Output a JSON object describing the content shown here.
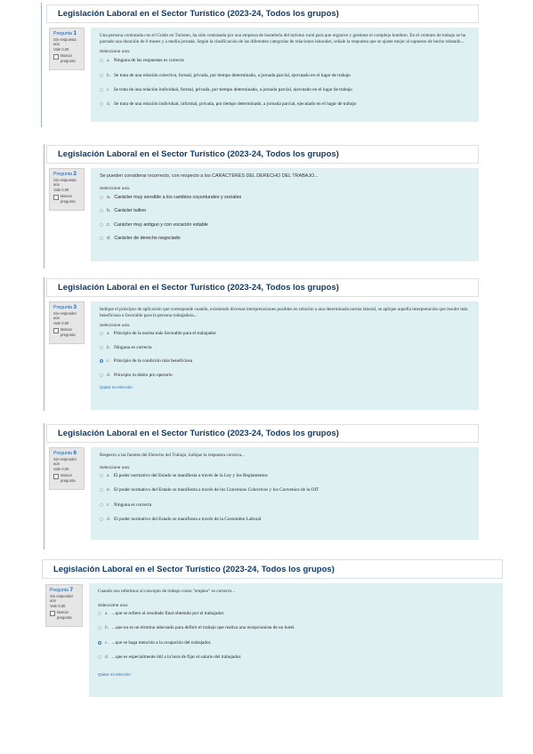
{
  "questions": [
    {
      "header": "Legislación Laboral en el Sector Turístico (2023-24, Todos los grupos)",
      "info": {
        "label": "Pregunta",
        "number": "1",
        "status": "Sin respuesta aún",
        "score": "Vale 0,00",
        "flag": "Marcar pregunta"
      },
      "text": "Una persona contratada con el Grado en Turismo, ha sido contratada por una empresa de hostelería del turismo rural para que organice y gestione el complejo hotelero. En el contrato de trabajo se ha pactado una duración de 6 meses y a media jornada. Según la clasificación de las diferentes categorías de relaciones laborales, señale la respuesta que se ajuste mejor al supuesto de hecho relatado...",
      "select_label": "Seleccione una:",
      "options": [
        {
          "letter": "a.",
          "text": "Ninguna de las respuestas es correcta"
        },
        {
          "letter": "b.",
          "text": "Se trata de una relación colectiva, formal, privada, por tiempo determinado, a jornada parcial, ejecutado en el lugar de trabajo"
        },
        {
          "letter": "c.",
          "text": "Se trata de una relación individual, formal, privada, por tiempo determinado, a jornada parcial, ejecutado en el lugar de trabajo"
        },
        {
          "letter": "d.",
          "text": "Se trata de una relación individual, informal, privada, por tiempo determinado, a jornada parcial, ejecutado en el lugar de trabajo"
        }
      ],
      "clear": ""
    },
    {
      "header": "Legislación Laboral en el Sector Turístico (2023-24, Todos los grupos)",
      "info": {
        "label": "Pregunta",
        "number": "2",
        "status": "Sin respuesta aún",
        "score": "Vale 0,00",
        "flag": "Marcar pregunta"
      },
      "text": "Se pueden considerar incorrecto, con respecto a los CARACTERES DEL DERECHO DEL TRABAJO...",
      "select_label": "Seleccione una:",
      "options": [
        {
          "letter": "a.",
          "text": "Carácter muy sensible a los cambios coyunturales y sociales"
        },
        {
          "letter": "b.",
          "text": "Carácter tuitivo"
        },
        {
          "letter": "c.",
          "text": "Carácter muy antiguo y con vocación estable"
        },
        {
          "letter": "d.",
          "text": "Carácter de derecho negociado"
        }
      ],
      "clear": ""
    },
    {
      "header": "Legislación Laboral en el Sector Turístico (2023-24, Todos los grupos)",
      "info": {
        "label": "Pregunta",
        "number": "3",
        "status": "Sin responder aún",
        "score": "Vale 0,00",
        "flag": "Marcar pregunta"
      },
      "text": "Indique el principio de aplicación que corresponde cuando, existiendo diversas interpretaciones posibles en relación a una determinada norma laboral, se aplique aquella interpretación que resulte más beneficiosa o favorable para la persona trabajadora...",
      "select_label": "Seleccione una:",
      "options": [
        {
          "letter": "a.",
          "text": "Principio de la norma más favorable para el trabajador"
        },
        {
          "letter": "b.",
          "text": "Ninguna es correcta"
        },
        {
          "letter": "c.",
          "text": "Principio de la condición más beneficiosa"
        },
        {
          "letter": "d.",
          "text": "Principio in dubio pro operario"
        }
      ],
      "clear": "Quitar mi elección"
    },
    {
      "header": "Legislación Laboral en el Sector Turístico (2023-24, Todos los grupos)",
      "info": {
        "label": "Pregunta",
        "number": "6",
        "status": "Sin responder aún",
        "score": "Vale 0,00",
        "flag": "Marcar pregunta"
      },
      "text": "Respecto a las fuentes del Derecho del Trabajo, indique la respuesta correcta...",
      "select_label": "Seleccione una:",
      "options": [
        {
          "letter": "a.",
          "text": "El poder normativo del Estado se manifiesta a través de la Ley y los Reglamentos"
        },
        {
          "letter": "b.",
          "text": "El poder normativo del Estado se manifiesta a través de los Convenios Colectivos y los Convenios de la OIT"
        },
        {
          "letter": "c.",
          "text": "Ninguna es correcta"
        },
        {
          "letter": "d.",
          "text": "El poder normativo del Estado se manifiesta a través de la Costumbre Laboral"
        }
      ],
      "clear": ""
    },
    {
      "header": "Legislación Laboral en el Sector Turístico (2023-24, Todos los grupos)",
      "info": {
        "label": "Pregunta",
        "number": "7",
        "status": "Sin responder aún",
        "score": "Vale 0,00",
        "flag": "Marcar pregunta"
      },
      "text": "Cuando nos referimos al concepto de trabajo como \"empleo\" es correcto...",
      "select_label": "Seleccione una:",
      "options": [
        {
          "letter": "a.",
          "text": "...que se refiere al resultado final obtenido por el trabajador."
        },
        {
          "letter": "b.",
          "text": "...que no es un término adecuado para definir el trabajo que realiza una recepcionista de un hotel."
        },
        {
          "letter": "c.",
          "text": "...que se haga mención a la ocupación del trabajador."
        },
        {
          "letter": "d.",
          "text": "...que es especialmente útil a la hora de fijar el salario del trabajador."
        }
      ],
      "clear": "Quitar mi elección"
    }
  ]
}
